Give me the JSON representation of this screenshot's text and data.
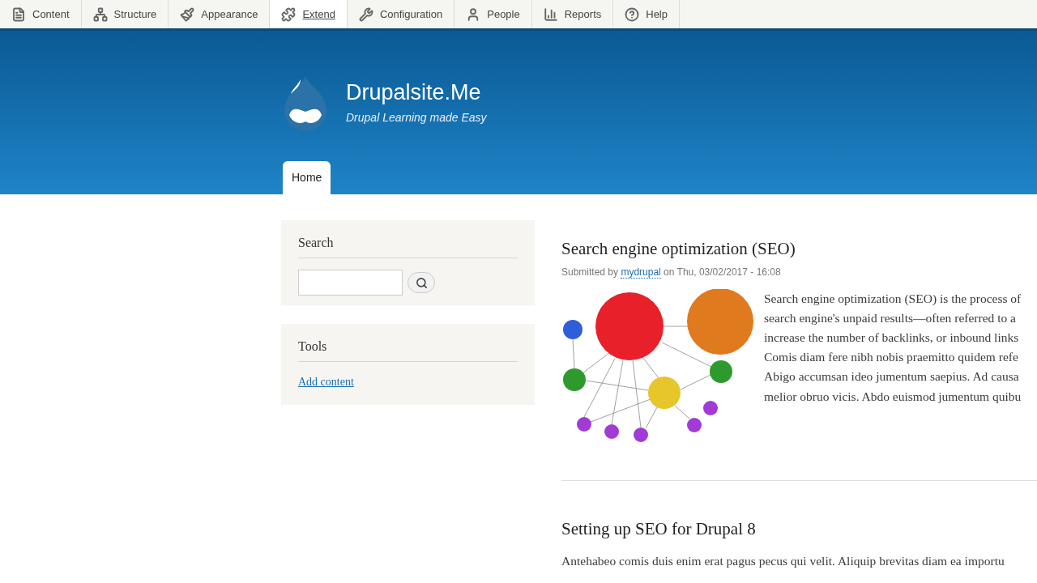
{
  "toolbar": [
    {
      "label": "Content",
      "hovered": false
    },
    {
      "label": "Structure",
      "hovered": false
    },
    {
      "label": "Appearance",
      "hovered": false
    },
    {
      "label": "Extend",
      "hovered": true
    },
    {
      "label": "Configuration",
      "hovered": false
    },
    {
      "label": "People",
      "hovered": false
    },
    {
      "label": "Reports",
      "hovered": false
    },
    {
      "label": "Help",
      "hovered": false
    }
  ],
  "header": {
    "site_name": "Drupalsite.Me",
    "slogan": "Drupal Learning made Easy",
    "tabs": [
      {
        "label": "Home",
        "selected": true
      }
    ]
  },
  "sidebar": {
    "search": {
      "title": "Search"
    },
    "tools": {
      "title": "Tools",
      "links": [
        "Add content"
      ]
    }
  },
  "articles": [
    {
      "title": "Search engine optimization (SEO)",
      "meta": {
        "prefix": "Submitted by",
        "author": "mydrupal",
        "date": "on Thu, 03/02/2017 - 16:08"
      },
      "lines": [
        "Search engine optimization (SEO) is the process of",
        "search engine's unpaid results—often referred to a",
        "increase the number of backlinks, or inbound links",
        "Comis diam fere nibh nobis praemitto quidem refe",
        "Abigo accumsan ideo jumentum saepius. Ad causa",
        "melior obruo vicis. Abdo euismod jumentum quibu"
      ]
    },
    {
      "title": "Setting up SEO for Drupal 8",
      "lines": [
        "Antehabeo comis duis enim erat pagus pecus qui velit. Aliquip brevitas diam ea importu"
      ]
    }
  ]
}
